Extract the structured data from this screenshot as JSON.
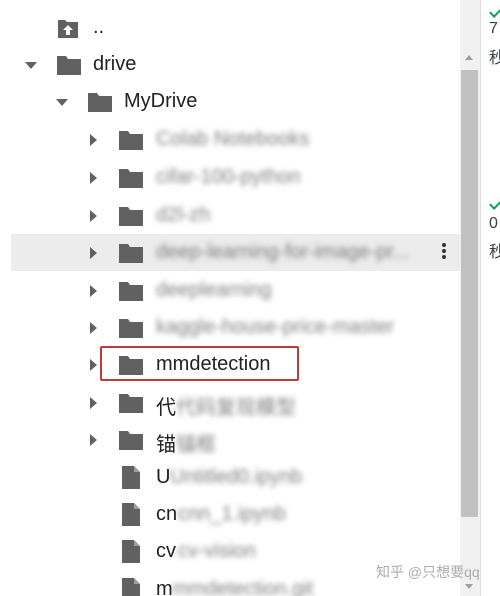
{
  "tree": {
    "parent_label": "..",
    "drive_label": "drive",
    "mydrive_label": "MyDrive",
    "folders": [
      {
        "label": "Colab Notebooks",
        "blurred": true
      },
      {
        "label": "cifar-100-python",
        "blurred": true
      },
      {
        "label": "d2l-zh",
        "blurred": true
      },
      {
        "label": "deep-learning-for-image-pr...",
        "blurred": true,
        "hover": true
      },
      {
        "label": "deeplearning",
        "blurred": true
      },
      {
        "label": "kaggle-house-price-master",
        "blurred": true
      },
      {
        "label": "mmdetection",
        "blurred": false,
        "highlighted": true
      },
      {
        "label": "代码复现模型",
        "blurred": true,
        "visible_prefix": "代"
      },
      {
        "label": "锚框",
        "blurred": true,
        "visible_prefix": "锚"
      }
    ],
    "files": [
      {
        "label": "Untitled0.ipynb",
        "visible_prefix": "U"
      },
      {
        "label": "cnn_1.ipynb",
        "visible_prefix": "cn"
      },
      {
        "label": "cv-vision",
        "visible_prefix": "cv"
      },
      {
        "label": "mmdetection.git",
        "visible_prefix": "m"
      }
    ]
  },
  "right_panel": {
    "line1": "7",
    "line2": "秒",
    "line3": "0",
    "line4": "秒"
  },
  "watermark": "知乎 @只想要qq",
  "colors": {
    "highlight": "#c0393b",
    "icon": "#616161",
    "check": "#0f9d58"
  }
}
